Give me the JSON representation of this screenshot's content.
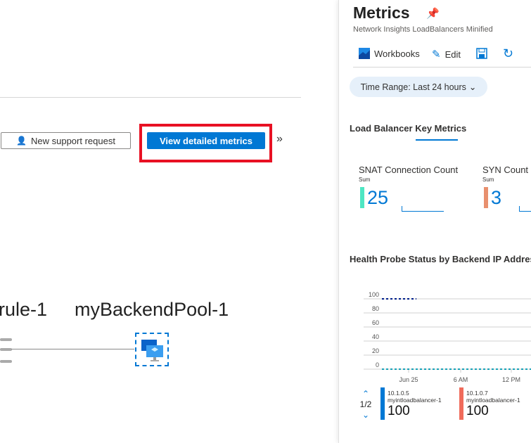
{
  "toolbar": {
    "support_label": "New support request",
    "metrics_label": "View detailed metrics",
    "expand_icon": "double-chevron-right"
  },
  "diagram": {
    "rule_label": "rule-1",
    "pool_label": "myBackendPool-1"
  },
  "panel": {
    "title": "Metrics",
    "subtitle": "Network Insights LoadBalancers Minified",
    "tools": {
      "workbooks": "Workbooks",
      "edit": "Edit"
    },
    "time_range": "Time Range: Last 24 hours",
    "key_metrics_title": "Load Balancer Key Metrics",
    "tiles": [
      {
        "name": "SNAT Connection Count",
        "agg": "Sum",
        "value": "25",
        "color": "#4ee6c3"
      },
      {
        "name": "SYN Count",
        "agg": "Sum",
        "value": "3",
        "color": "#e8906e"
      }
    ],
    "health_title": "Health Probe Status by Backend IP Address",
    "pager": "1/2",
    "legend": [
      {
        "ip": "10.1.0.5",
        "lb": "myintloadbalancer-1",
        "value": "100",
        "color": "#0078d4"
      },
      {
        "ip": "10.1.0.7",
        "lb": "myintloadbalancer-1",
        "value": "100",
        "color": "#f06b5b"
      }
    ]
  },
  "chart_data": {
    "type": "line",
    "ylim": [
      0,
      100
    ],
    "yticks": [
      "100",
      "80",
      "60",
      "40",
      "20",
      "0"
    ],
    "xticks": [
      "Jun 25",
      "6 AM",
      "12 PM"
    ],
    "grid": true,
    "series": [
      {
        "values": [
          100,
          100,
          100
        ],
        "color": "#001f8c"
      },
      {
        "values": [
          0,
          0,
          0
        ],
        "color": "#17a2b8"
      }
    ]
  }
}
